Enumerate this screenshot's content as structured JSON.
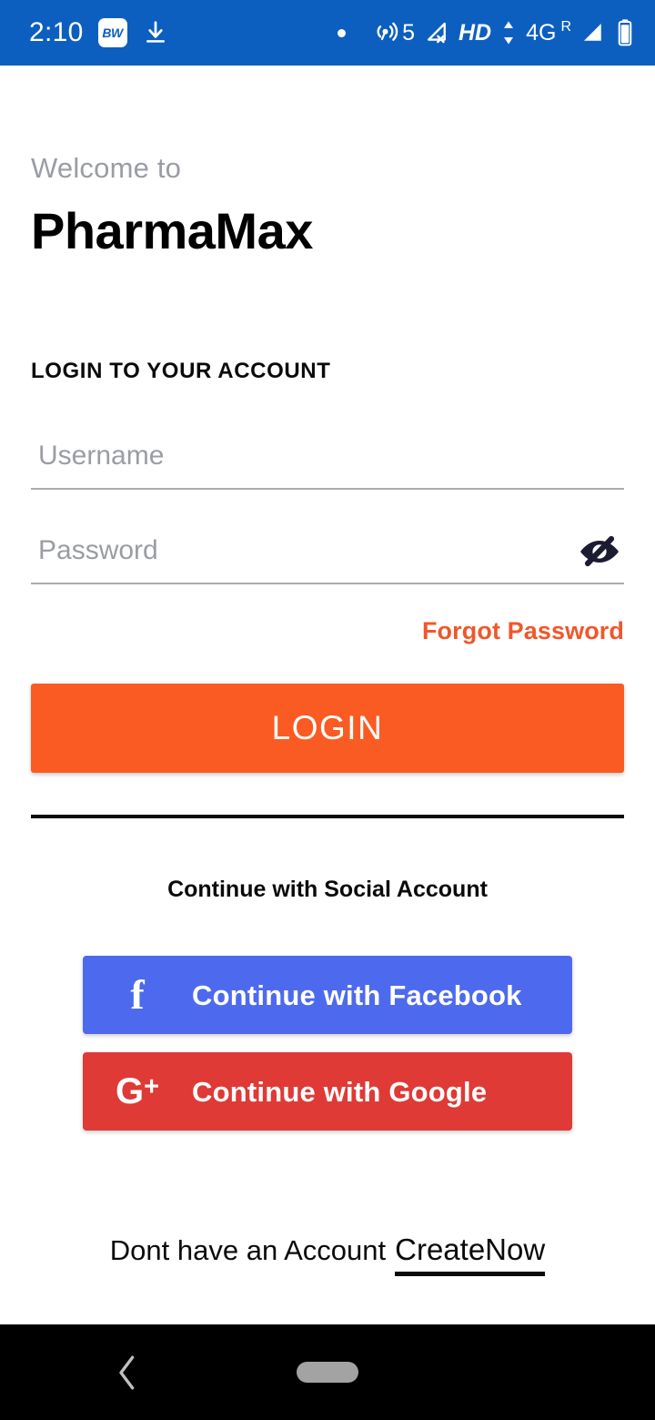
{
  "status_bar": {
    "time": "2:10",
    "app_badge_label": "BW",
    "download_icon": "download-icon",
    "notification_dot": "notification-dot",
    "hotspot_icon": "hotspot-icon",
    "hotspot_count": "5",
    "signal_off_icon": "signal-off-icon",
    "hd_label": "HD",
    "data_transfer_icon": "data-transfer-arrows-icon",
    "network_label": "4G",
    "roaming_label": "R",
    "signal_icon": "signal-bars-icon",
    "battery_icon": "battery-icon",
    "background_color": "#0C5FBF"
  },
  "header": {
    "welcome_label": "Welcome to",
    "app_name": "PharmaMax"
  },
  "login": {
    "section_heading": "LOGIN TO YOUR ACCOUNT",
    "username": {
      "placeholder": "Username",
      "value": ""
    },
    "password": {
      "placeholder": "Password",
      "value": "",
      "toggle_icon": "eye-off-icon"
    },
    "forgot_password_label": "Forgot Password",
    "forgot_password_color": "#F0572B",
    "login_button_label": "LOGIN",
    "login_button_color": "#FA5B23"
  },
  "social": {
    "heading": "Continue with Social Account",
    "facebook": {
      "label": "Continue with Facebook",
      "icon": "facebook-icon",
      "glyph": "f",
      "color": "#4D6AEE"
    },
    "google": {
      "label": "Continue with Google",
      "icon": "google-plus-icon",
      "glyph": "G",
      "plus": "+",
      "color": "#DF3A36"
    }
  },
  "footer": {
    "no_account_text": "Dont have an Account",
    "create_now_label": "CreateNow"
  },
  "nav_bar": {
    "back_icon": "back-chevron-icon",
    "home_indicator": "home-pill-indicator",
    "background_color": "#000000"
  }
}
